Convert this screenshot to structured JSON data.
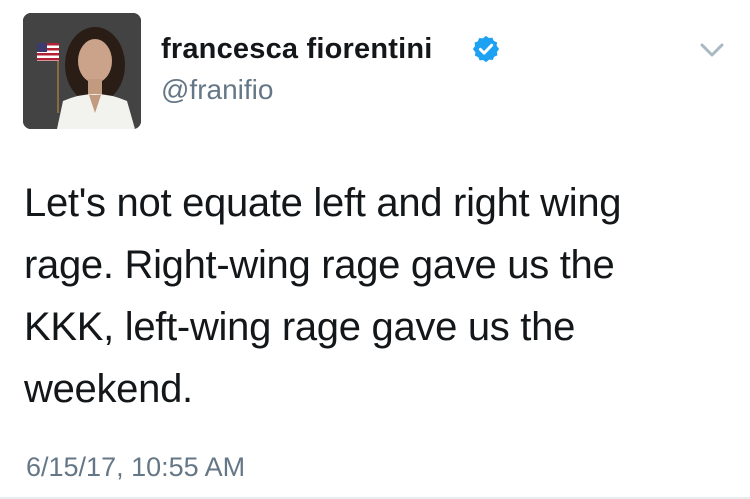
{
  "author": {
    "display_name": "francesca fiorentini",
    "handle": "@franifio",
    "verified": true,
    "avatar_icon": "profile-photo-with-american-flag"
  },
  "tweet": {
    "text_lines": [
      "Let's not equate left and right wing",
      "rage. Right-wing rage gave us the",
      "KKK, left-wing rage gave us the",
      "weekend."
    ],
    "timestamp": "6/15/17, 10:55 AM"
  },
  "icons": {
    "verified": "verified-badge-icon",
    "menu": "chevron-down-icon"
  },
  "colors": {
    "verified_blue": "#1da1f2",
    "text": "#14171a",
    "secondary_text": "#657786"
  }
}
